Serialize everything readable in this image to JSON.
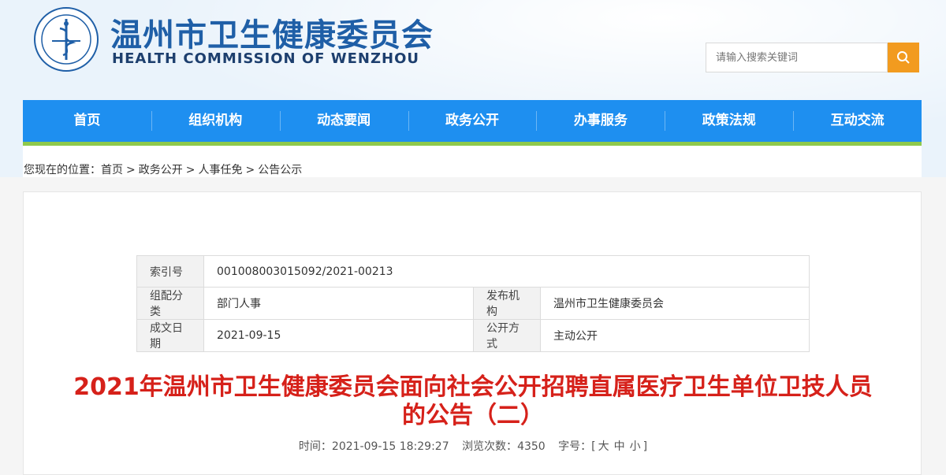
{
  "header": {
    "title_cn": "温州市卫生健康委员会",
    "title_en": "HEALTH COMMISSION OF WENZHOU",
    "search_placeholder": "请输入搜索关键词",
    "colors": {
      "brand": "#1f5fa7",
      "search_button": "#f29b1f"
    }
  },
  "nav": {
    "items": [
      "首页",
      "组织机构",
      "动态要闻",
      "政务公开",
      "办事服务",
      "政策法规",
      "互动交流"
    ],
    "colors": {
      "bar": "#1e8ff0",
      "underline": "#8fc94b"
    }
  },
  "breadcrumb": {
    "prefix": "您现在的位置：",
    "items": [
      "首页",
      "政务公开",
      "人事任免",
      "公告公示"
    ],
    "separator": ">"
  },
  "meta": {
    "index_label": "索引号",
    "index_value": "001008003015092/2021-00213",
    "category_label": "组配分类",
    "category_value": "部门人事",
    "publisher_label": "发布机构",
    "publisher_value": "温州市卫生健康委员会",
    "date_label": "成文日期",
    "date_value": "2021-09-15",
    "disclosure_label": "公开方式",
    "disclosure_value": "主动公开"
  },
  "article": {
    "title_line1": "2021年温州市卫生健康委员会面向社会公开招聘直属医疗卫生单位卫技人员",
    "title_line2": "的公告（二）",
    "time_label": "时间：",
    "time_value": "2021-09-15 18:29:27",
    "views_label": "浏览次数：",
    "views_value": "4350",
    "font_label": "字号：",
    "font_open": "[",
    "font_large": "大",
    "font_medium": "中",
    "font_small": "小",
    "font_close": "]",
    "title_color": "#d6211a"
  }
}
